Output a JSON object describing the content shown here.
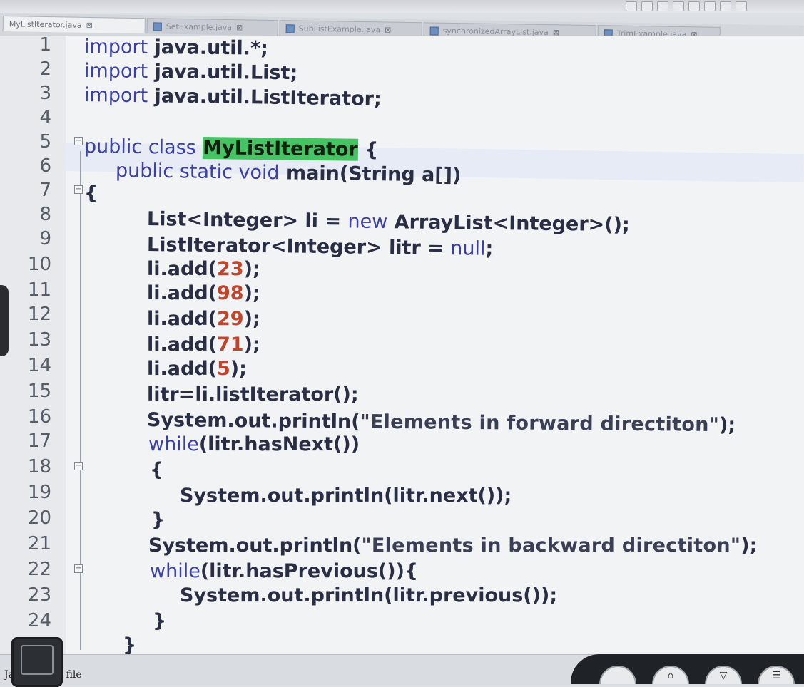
{
  "tabs": [
    {
      "label": "MyListIterator.java",
      "active": true
    },
    {
      "label": "SetExample.java",
      "active": false
    },
    {
      "label": "SubListExample.java",
      "active": false
    },
    {
      "label": "synchronizedArrayList.java",
      "active": false
    },
    {
      "label": "TrimExample.java",
      "active": false
    }
  ],
  "line_numbers": [
    "1",
    "2",
    "3",
    "4",
    "5",
    "6",
    "7",
    "8",
    "9",
    "10",
    "11",
    "12",
    "13",
    "14",
    "15",
    "16",
    "17",
    "18",
    "19",
    "20",
    "21",
    "22",
    "23",
    "24"
  ],
  "code": {
    "l1_kw": "import",
    "l1_rest": " java.util.*;",
    "l2_kw": "import",
    "l2_rest": " java.util.List;",
    "l3_kw": "import",
    "l3_rest": " java.util.ListIterator;",
    "l5_kw": "public class",
    "l5_hl": "MyListIterator",
    "l5_rest": " {",
    "l6_kw": "public static void",
    "l6_rest": " main(String a[])",
    "l7": "{",
    "l8_a": "List<Integer> li = ",
    "l8_kw": "new",
    "l8_b": " ArrayList<Integer>();",
    "l9_a": "ListIterator<Integer> litr = ",
    "l9_kw": "null",
    "l9_b": ";",
    "l10_a": "li.add(",
    "l10_n": "23",
    "l10_b": ");",
    "l11_a": "li.add(",
    "l11_n": "98",
    "l11_b": ");",
    "l12_a": "li.add(",
    "l12_n": "29",
    "l12_b": ");",
    "l13_a": "li.add(",
    "l13_n": "71",
    "l13_b": ");",
    "l14_a": "li.add(",
    "l14_n": "5",
    "l14_b": ");",
    "l15": "litr=li.listIterator();",
    "l16_a": "System.out.println(",
    "l16_s": "\"Elements in forward directiton\"",
    "l16_b": ");",
    "l17_kw": "while",
    "l17_rest": "(litr.hasNext())",
    "l18": "{",
    "l19": "System.out.println(litr.next());",
    "l20": "}",
    "l21_a": "System.out.println(",
    "l21_s": "\"Elements in backward directiton\"",
    "l21_b": ");",
    "l22_kw": "while",
    "l22_rest": "(litr.hasPrevious()){",
    "l23": "System.out.println(litr.previous());",
    "l24": "}",
    "l25": "}"
  },
  "status": {
    "text": "Java source file"
  }
}
